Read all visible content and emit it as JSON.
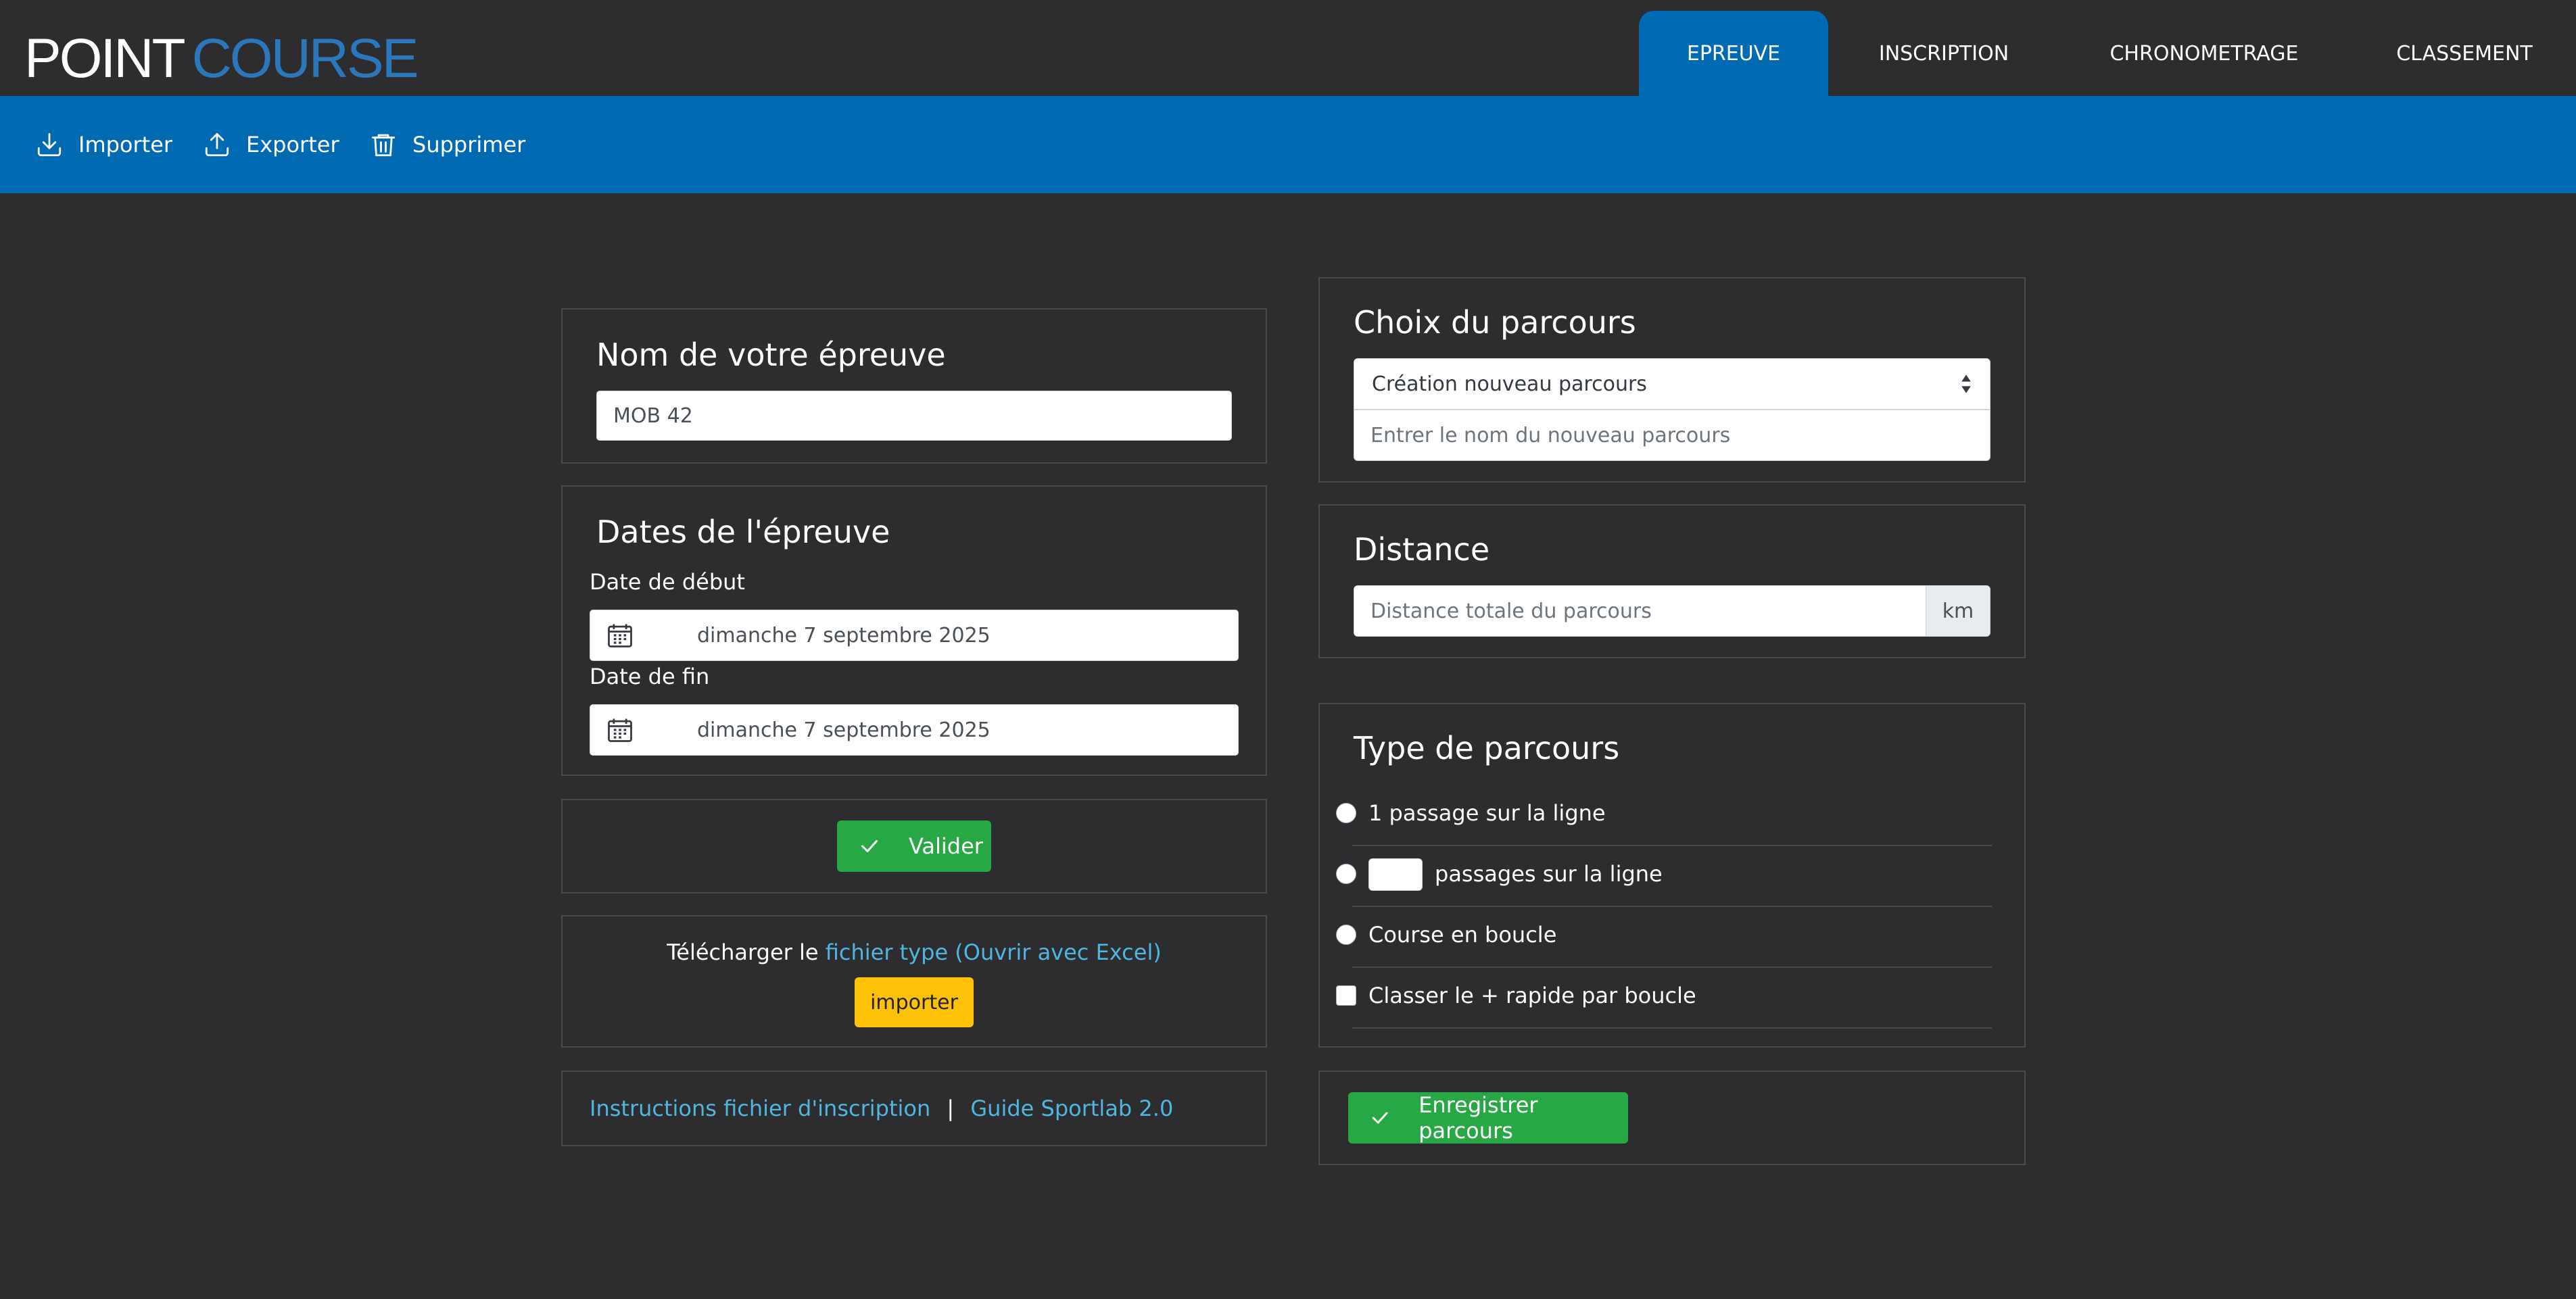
{
  "logo": {
    "part1": "POINT",
    "part2": "COURSE"
  },
  "tabs": [
    {
      "label": "EPREUVE",
      "active": true
    },
    {
      "label": "INSCRIPTION",
      "active": false
    },
    {
      "label": "CHRONOMETRAGE",
      "active": false
    },
    {
      "label": "CLASSEMENT",
      "active": false
    }
  ],
  "toolbar": {
    "import_label": "Importer",
    "export_label": "Exporter",
    "delete_label": "Supprimer"
  },
  "event_name": {
    "title": "Nom de votre épreuve",
    "value": "MOB 42"
  },
  "dates": {
    "title": "Dates de l'épreuve",
    "start_label": "Date de début",
    "start_value": "dimanche 7 septembre 2025",
    "end_label": "Date de fin",
    "end_value": "dimanche 7 septembre 2025"
  },
  "validate_label": "Valider",
  "download": {
    "text": "Télécharger le",
    "link": "fichier type (Ouvrir avec Excel)",
    "button": "importer"
  },
  "links": {
    "instructions": "Instructions fichier d'inscription",
    "separator": "|",
    "guide": "Guide Sportlab 2.0"
  },
  "course_choice": {
    "title": "Choix du parcours",
    "selected": "Création nouveau parcours",
    "name_placeholder": "Entrer le nom du nouveau parcours"
  },
  "distance": {
    "title": "Distance",
    "placeholder": "Distance totale du parcours",
    "unit": "km"
  },
  "course_type": {
    "title": "Type de parcours",
    "option1": "1 passage sur la ligne",
    "option2": "passages sur la ligne",
    "option3": "Course en boucle",
    "checkbox": "Classer le + rapide par boucle"
  },
  "save_course_label": "Enregistrer parcours",
  "colors": {
    "background": "#2d2d2f",
    "primary": "#006ab3",
    "success": "#28a745",
    "warning": "#ffc107",
    "link": "#4fb6e0"
  }
}
